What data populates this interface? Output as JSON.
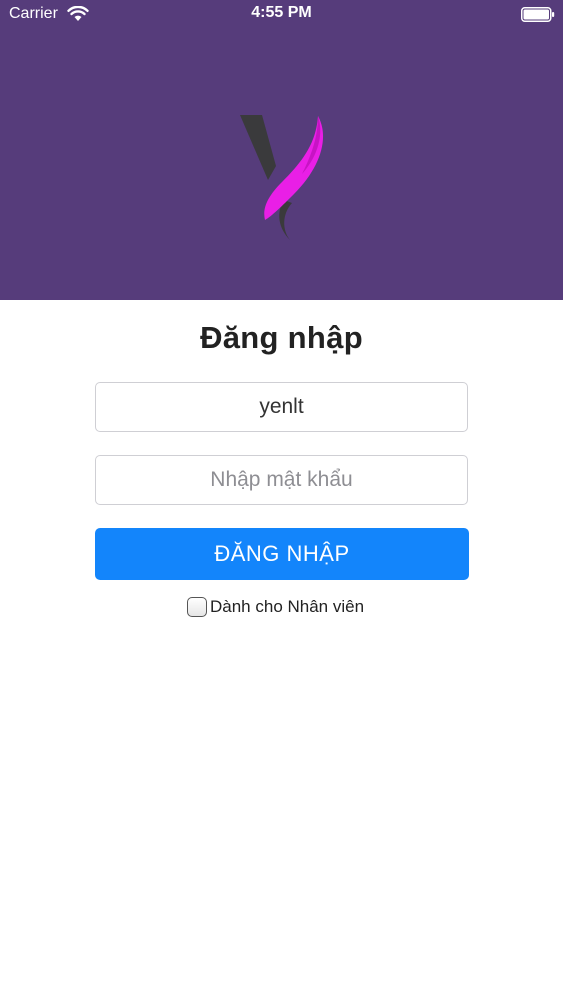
{
  "status_bar": {
    "carrier": "Carrier",
    "time": "4:55 PM",
    "icons": [
      "wifi-icon",
      "battery-icon"
    ]
  },
  "header": {
    "background_color": "#563c7b",
    "logo": "brand-logo-y"
  },
  "login": {
    "title": "Đăng nhập",
    "username_value": "yenlt",
    "password_placeholder": "Nhập mật khẩu",
    "submit_label": "ĐĂNG NHẬP",
    "staff_checkbox_label": "Dành cho Nhân viên",
    "staff_checkbox_checked": false
  },
  "colors": {
    "accent": "#1385fb",
    "logo_magenta": "#e91fe6",
    "logo_dark": "#3a3a3c"
  }
}
